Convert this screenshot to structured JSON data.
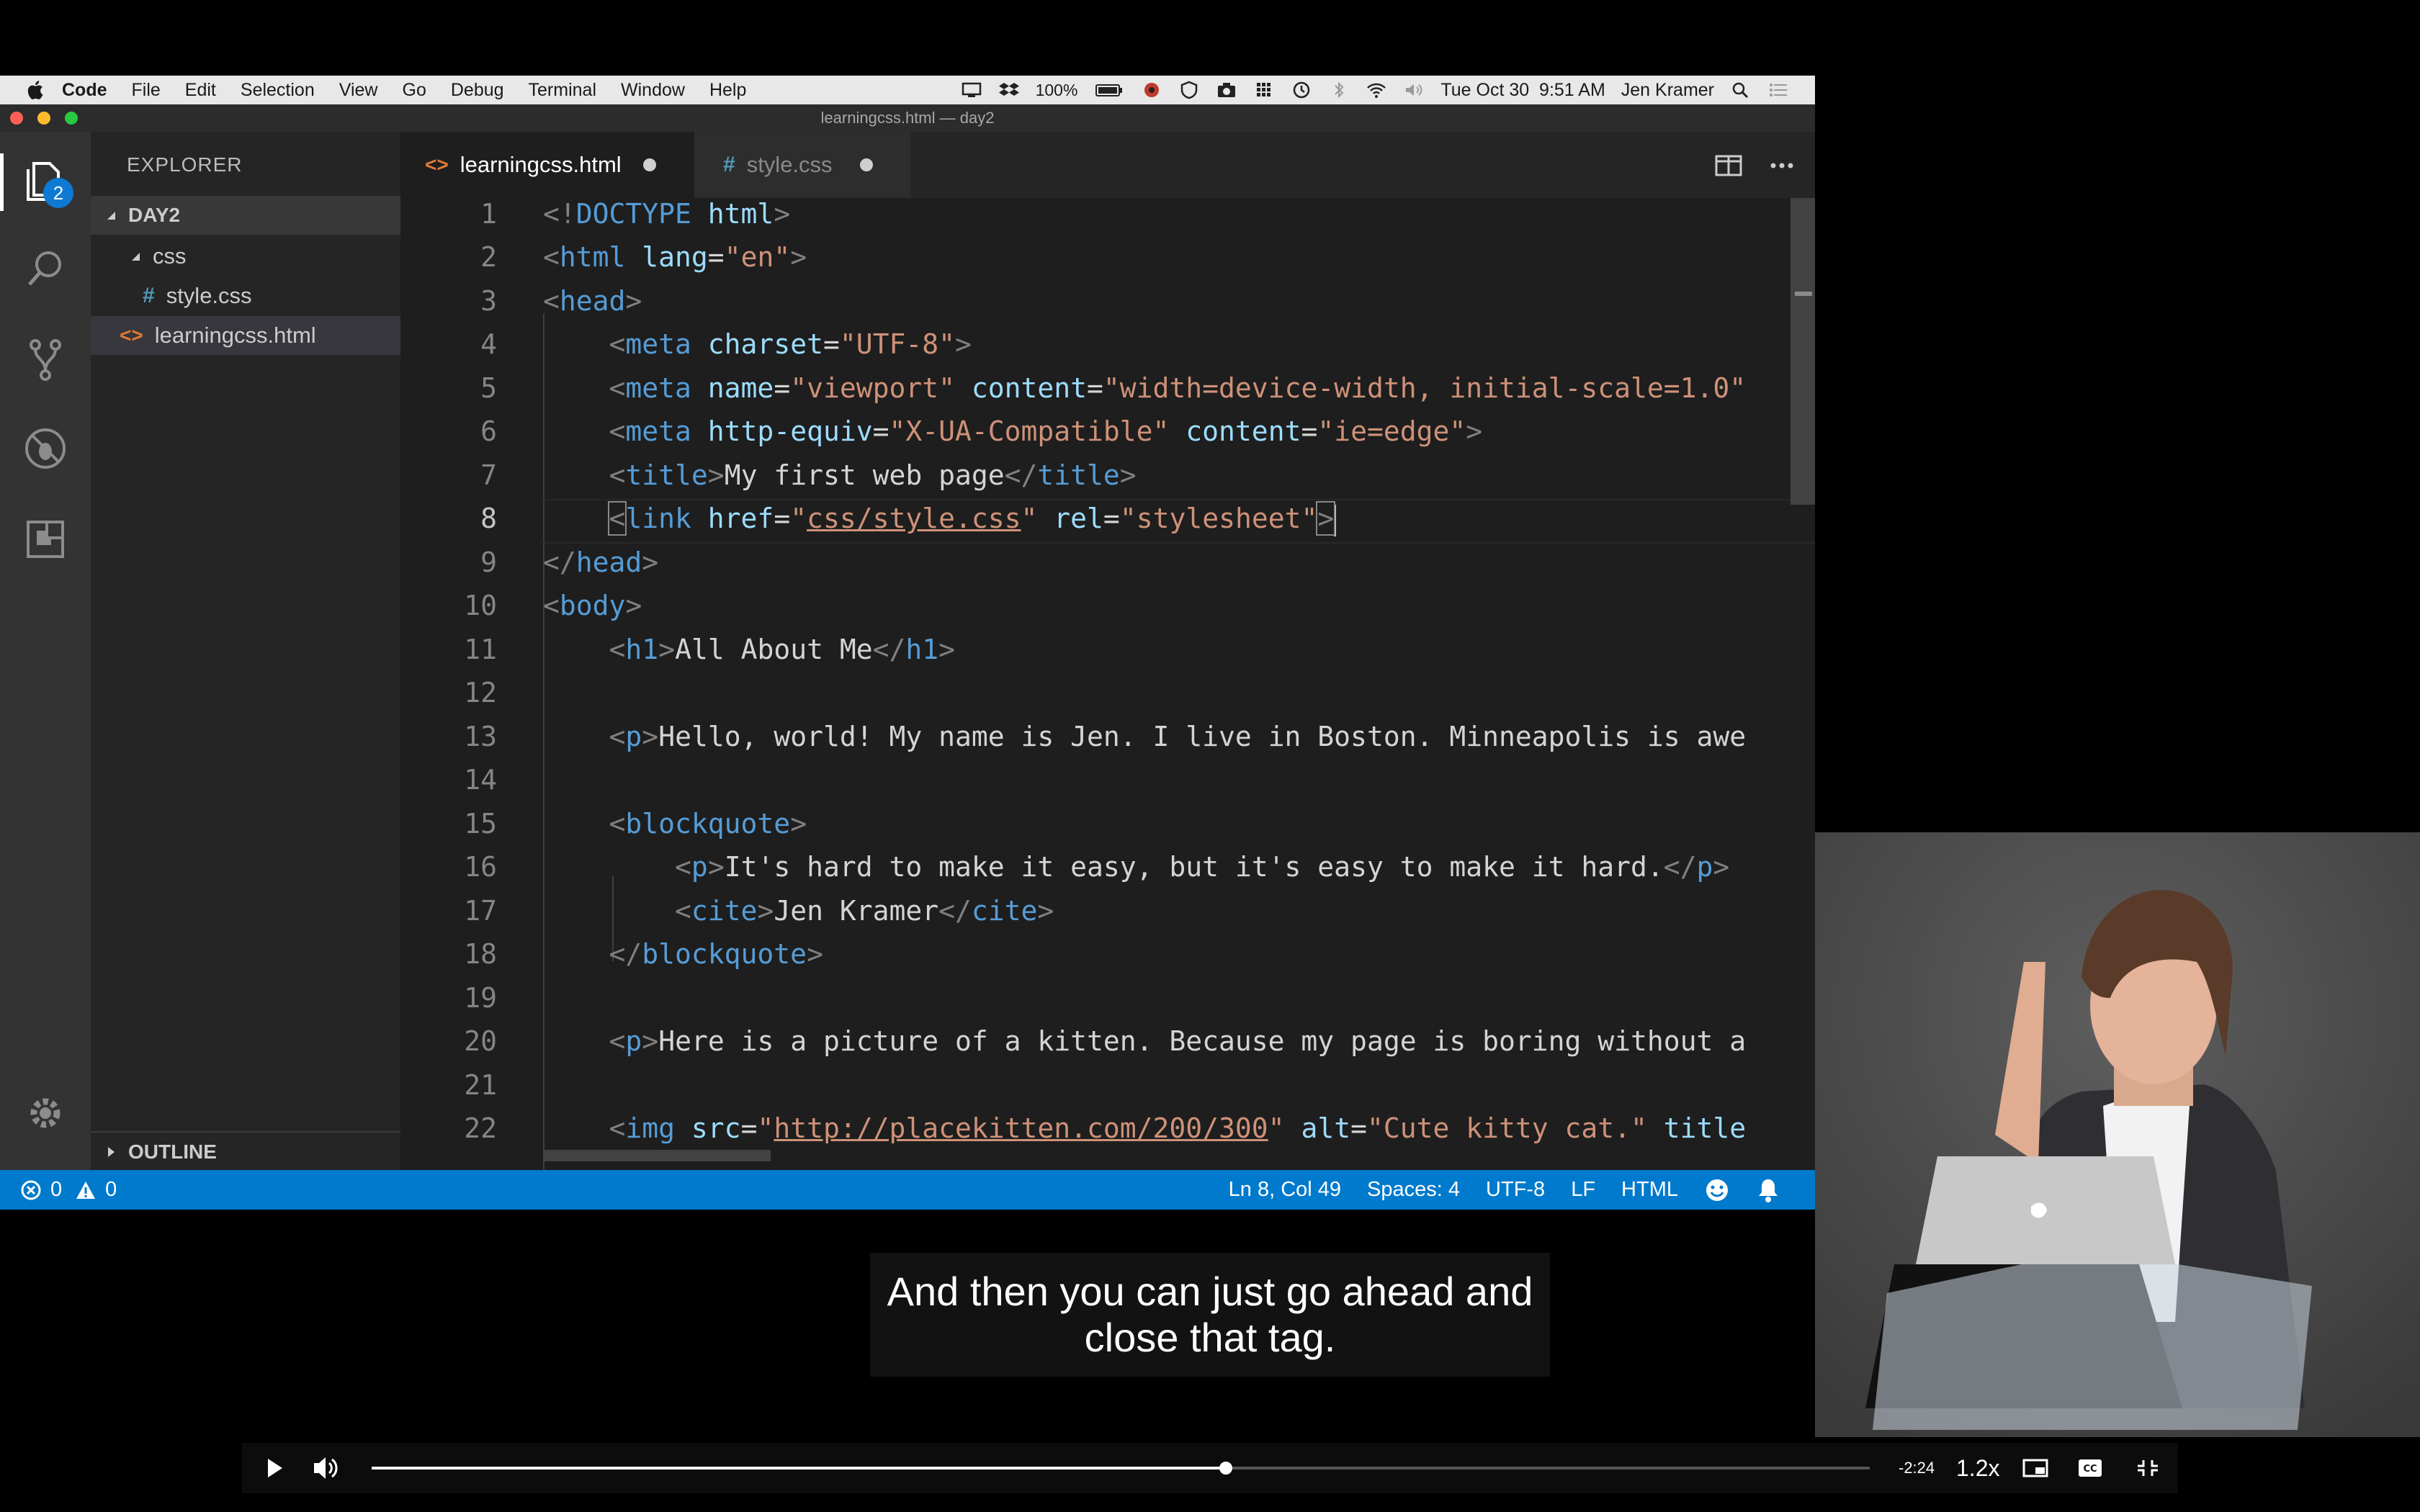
{
  "menubar": {
    "app": "Code",
    "menus": [
      "File",
      "Edit",
      "Selection",
      "View",
      "Go",
      "Debug",
      "Terminal",
      "Window",
      "Help"
    ],
    "battery": "100%",
    "clock": "Tue Oct 30  9:51 AM",
    "user": "Jen Kramer"
  },
  "window": {
    "title": "learningcss.html — day2"
  },
  "activity": {
    "explorer_badge": "2"
  },
  "sidebar": {
    "header": "EXPLORER",
    "folder": "DAY2",
    "subfolder": "css",
    "css_file": "style.css",
    "html_file": "learningcss.html",
    "outline": "OUTLINE"
  },
  "tabs": [
    {
      "label": "learningcss.html",
      "active": true
    },
    {
      "label": "style.css",
      "active": false
    }
  ],
  "editor": {
    "current_line": 8,
    "line_numbers": [
      "1",
      "2",
      "3",
      "4",
      "5",
      "6",
      "7",
      "8",
      "9",
      "10",
      "11",
      "12",
      "13",
      "14",
      "15",
      "16",
      "17",
      "18",
      "19",
      "20",
      "21",
      "22"
    ],
    "lines": {
      "l1": [
        "<!",
        "DOCTYPE",
        " html",
        ">"
      ],
      "l2": [
        "<",
        "html",
        " lang",
        "=",
        "\"en\"",
        ">"
      ],
      "l3": [
        "<",
        "head",
        ">"
      ],
      "l4": [
        "<",
        "meta",
        " charset",
        "=",
        "\"UTF-8\"",
        ">"
      ],
      "l5": [
        "<",
        "meta",
        " name",
        "=",
        "\"viewport\"",
        " content",
        "=",
        "\"width=device-width, initial-scale=1.0\""
      ],
      "l6": [
        "<",
        "meta",
        " http-equiv",
        "=",
        "\"X-UA-Compatible\"",
        " content",
        "=",
        "\"ie=edge\"",
        ">"
      ],
      "l7": [
        "<",
        "title",
        ">",
        "My first web page",
        "</",
        "title",
        ">"
      ],
      "l8": [
        "<",
        "link",
        " href",
        "=",
        "\"",
        "css/style.css",
        "\"",
        " rel",
        "=",
        "\"stylesheet\"",
        ">"
      ],
      "l9": [
        "</",
        "head",
        ">"
      ],
      "l10": [
        "<",
        "body",
        ">"
      ],
      "l11": [
        "<",
        "h1",
        ">",
        "All About Me",
        "</",
        "h1",
        ">"
      ],
      "l13": [
        "<",
        "p",
        ">",
        "Hello, world! My name is Jen. I live in Boston. Minneapolis is awe"
      ],
      "l15": [
        "<",
        "blockquote",
        ">"
      ],
      "l16": [
        "<",
        "p",
        ">",
        "It's hard to make it easy, but it's easy to make it hard.",
        "</",
        "p",
        ">"
      ],
      "l17": [
        "<",
        "cite",
        ">",
        "Jen Kramer",
        "</",
        "cite",
        ">"
      ],
      "l18": [
        "</",
        "blockquote",
        ">"
      ],
      "l20": [
        "<",
        "p",
        ">",
        "Here is a picture of a kitten. Because my page is boring without a"
      ],
      "l22": [
        "<",
        "img",
        " src",
        "=",
        "\"",
        "http://placekitten.com/200/300",
        "\"",
        " alt",
        "=",
        "\"Cute kitty cat.\"",
        " title"
      ]
    }
  },
  "statusbar": {
    "errors": "0",
    "warnings": "0",
    "position": "Ln 8, Col 49",
    "spaces": "Spaces: 4",
    "encoding": "UTF-8",
    "eol": "LF",
    "language": "HTML"
  },
  "caption": {
    "line1": "And then you can just go ahead and",
    "line2": "close that tag."
  },
  "player": {
    "time_remaining": "-2:24",
    "speed": "1.2x",
    "progress": 0.57
  },
  "colors": {
    "accent": "#007acc",
    "tag": "#569cd6",
    "attribute": "#9cdcfe",
    "string": "#ce9178",
    "punctuation": "#808080"
  }
}
